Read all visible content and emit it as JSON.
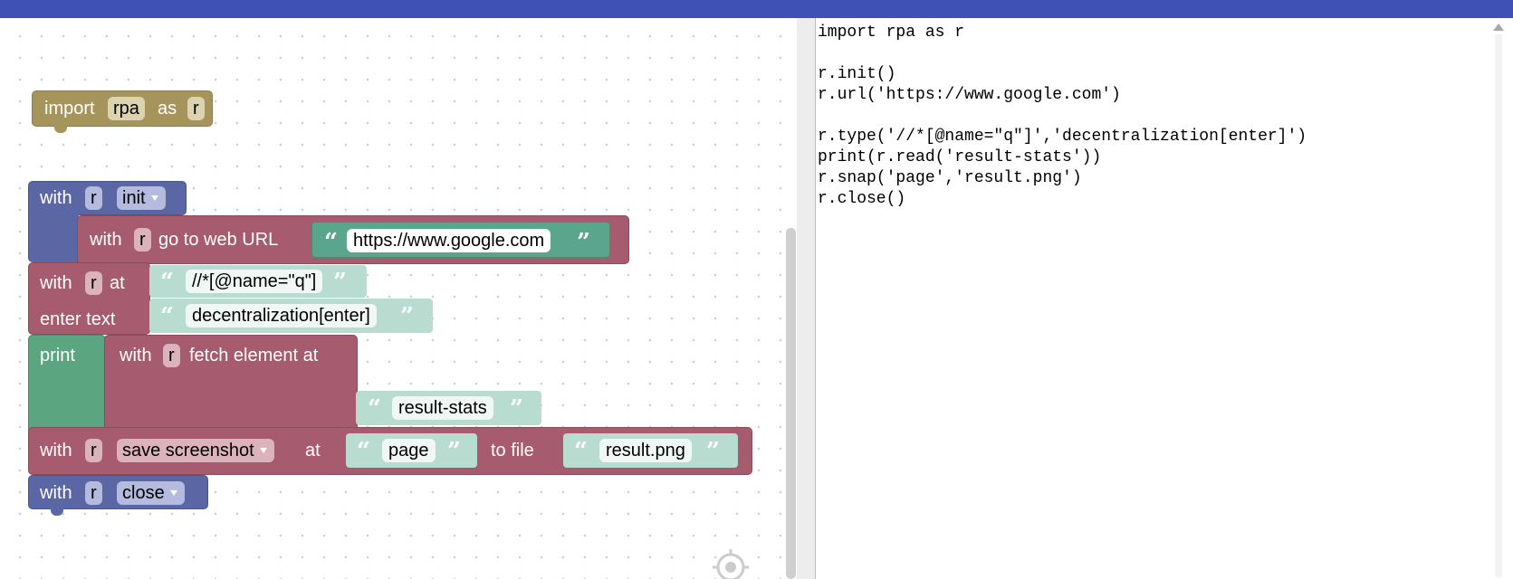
{
  "colors": {
    "header": "#3f51b5",
    "import_block": "#a5955c",
    "with_block": "#5b67a5",
    "web_block": "#a65b6e",
    "print_block": "#5ba580",
    "string_block": "#5ba58c",
    "string_block_light": "#b8ddd0"
  },
  "blocks": {
    "import": {
      "kw_import": "import",
      "module": "rpa",
      "kw_as": "as",
      "alias": "r"
    },
    "init": {
      "kw_with": "with",
      "var": "r",
      "action": "init"
    },
    "url": {
      "kw_with": "with",
      "var": "r",
      "text": "go to web URL",
      "value": "https://www.google.com"
    },
    "type": {
      "kw_with": "with",
      "var": "r",
      "kw_at": "at",
      "selector": "//*[@name=\"q\"]",
      "enter_text": "enter text",
      "text_value": "decentralization[enter]"
    },
    "print": {
      "kw_print": "print",
      "kw_with": "with",
      "var": "r",
      "text": "fetch element at",
      "element": "result-stats"
    },
    "snap": {
      "kw_with": "with",
      "var": "r",
      "action": "save screenshot",
      "kw_at": "at",
      "target": "page",
      "to_file": "to file",
      "file": "result.png"
    },
    "close": {
      "kw_with": "with",
      "var": "r",
      "action": "close"
    }
  },
  "quote_open": "“",
  "quote_close": "”",
  "code_lines": [
    "import rpa as r",
    "",
    "r.init()",
    "r.url('https://www.google.com')",
    "",
    "r.type('//*[@name=\"q\"]','decentralization[enter]')",
    "print(r.read('result-stats'))",
    "r.snap('page','result.png')",
    "r.close()"
  ]
}
